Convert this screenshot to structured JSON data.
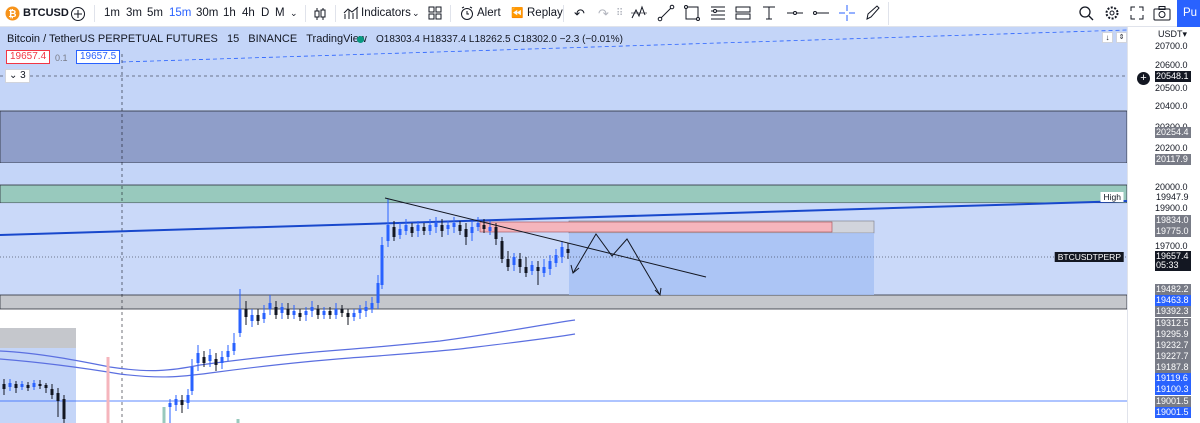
{
  "toolbar": {
    "symbol": "BTCUSD",
    "intervals": [
      "1m",
      "3m",
      "5m",
      "15m",
      "30m",
      "1h",
      "4h",
      "D",
      "M"
    ],
    "active_interval": "15m",
    "indicators_label": "Indicators",
    "alert_label": "Alert",
    "replay_label": "Replay",
    "publish_label": "Pu"
  },
  "legend": {
    "title": "Bitcoin / TetherUS PERPETUAL FUTURES",
    "interval": "15",
    "exchange": "BINANCE",
    "source": "TradingView",
    "o_label": "O",
    "o": "18303.4",
    "h_label": "H",
    "h": "18337.4",
    "l_label": "L",
    "l": "18262.5",
    "c_label": "C",
    "c": "18302.0",
    "change": "−2.3 (−0.01%)",
    "bid": "19657.4",
    "spread": "0.1",
    "ask": "19657.5",
    "indicator_count": "3"
  },
  "axis": {
    "currency": "USDT",
    "ticks": [
      "20700.0",
      "20600.0",
      "20500.0",
      "20400.0",
      "20300.0",
      "20200.0",
      "20000.0",
      "19900.0",
      "19700.0"
    ],
    "labels": [
      {
        "text": "20548.1",
        "bg": "#131722"
      },
      {
        "text": "20254.4",
        "bg": "#787b86"
      },
      {
        "text": "20117.9",
        "bg": "#787b86"
      },
      {
        "text": "19947.9",
        "bg": "#ffffff"
      },
      {
        "text": "19834.0",
        "bg": "#787b86"
      },
      {
        "text": "19775.0",
        "bg": "#787b86"
      },
      {
        "text": "19657.4",
        "bg": "#131722"
      },
      {
        "text": "05:33",
        "bg": "#131722"
      },
      {
        "text": "19482.2",
        "bg": "#787b86"
      },
      {
        "text": "19463.8",
        "bg": "#2962ff"
      },
      {
        "text": "19392.3",
        "bg": "#787b86"
      },
      {
        "text": "19312.5",
        "bg": "#787b86"
      },
      {
        "text": "19295.9",
        "bg": "#787b86"
      },
      {
        "text": "19232.7",
        "bg": "#787b86"
      },
      {
        "text": "19227.7",
        "bg": "#787b86"
      },
      {
        "text": "19187.8",
        "bg": "#787b86"
      },
      {
        "text": "19119.6",
        "bg": "#2962ff"
      },
      {
        "text": "19100.3",
        "bg": "#2962ff"
      },
      {
        "text": "19001.5",
        "bg": "#787b86"
      },
      {
        "text": "19001.5",
        "bg": "#2962ff"
      }
    ]
  },
  "chart": {
    "high_label": "High",
    "symbol_label": "BTCUSDTPERP"
  },
  "colors": {
    "zone_blue": "#c4d5f8",
    "zone_dark": "#8f9ec9",
    "zone_green": "#98c9bd",
    "candle_up": "#2962ff",
    "candle_down": "#131722",
    "ma": "#5b6fe0"
  }
}
